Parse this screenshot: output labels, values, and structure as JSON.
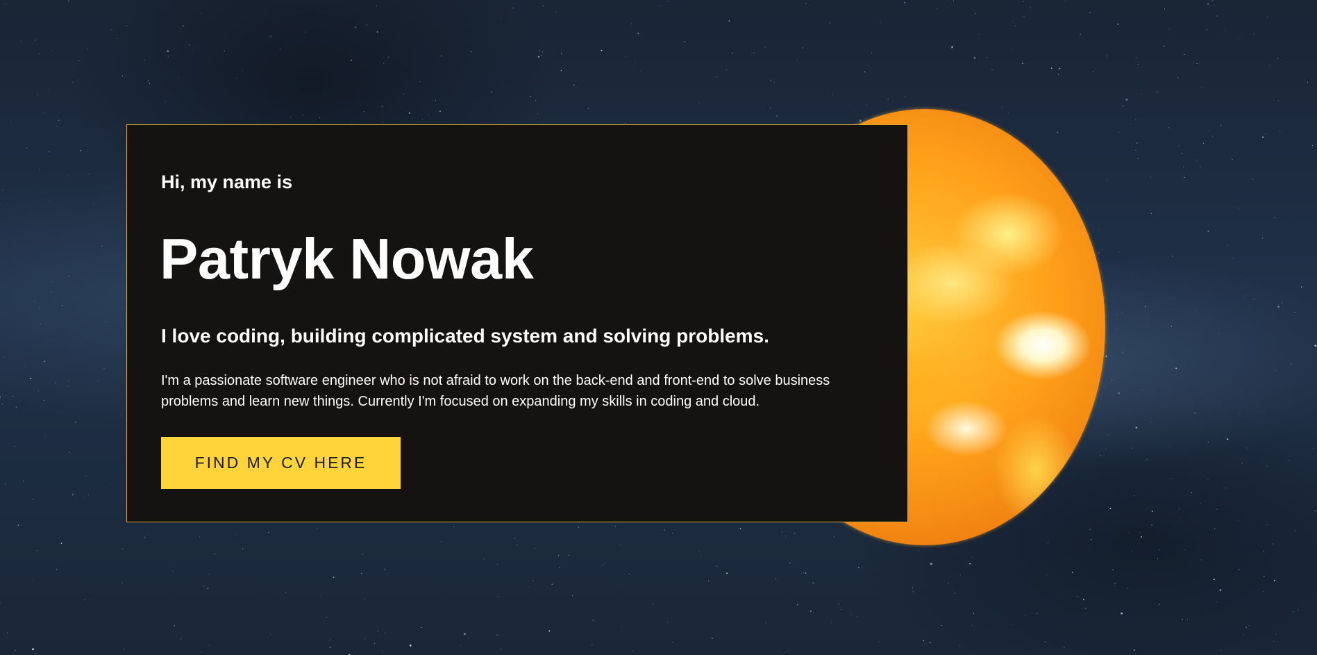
{
  "hero": {
    "greeting": "Hi, my name is",
    "name": "Patryk Nowak",
    "tagline": "I love coding, building complicated system and solving problems.",
    "bio": "I'm a passionate software engineer who is not afraid to work on the back-end and front-end to solve business problems and learn new things. Currently I'm focused on expanding my skills in coding and cloud.",
    "cv_button_label": "FIND MY CV HERE"
  },
  "colors": {
    "background": "#1b2a3e",
    "card_background": "#141311",
    "card_border": "#d4a838",
    "accent": "#ffd43a",
    "sun": "#ffa21a",
    "text": "#ffffff"
  },
  "decor": {
    "background_image": "starfield",
    "planet_image": "sun-icon"
  }
}
